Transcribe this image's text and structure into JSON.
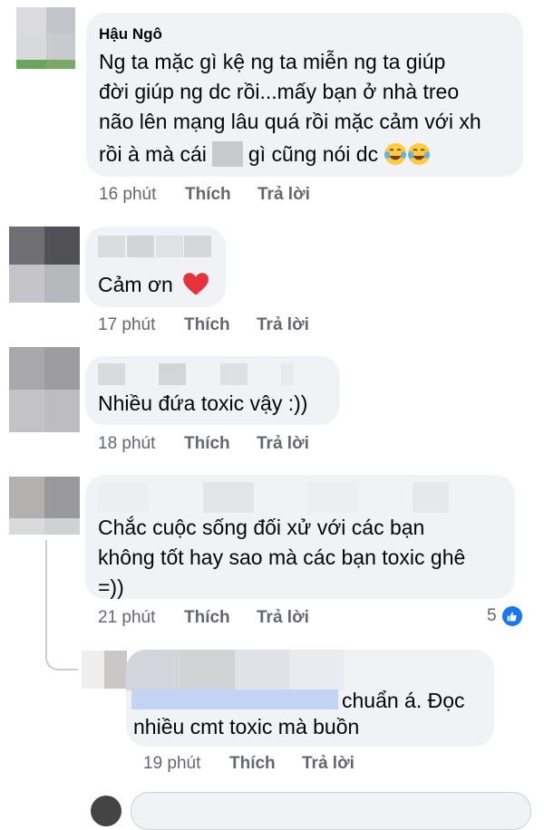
{
  "comments": [
    {
      "author": "Hậu Ngô",
      "text_line1": "Ng ta mặc gì kệ ng ta miễn ng ta giúp",
      "text_line2": "đời giúp ng dc rồi...mấy bạn ở nhà treo",
      "text_line3": "não lên mạng lâu quá rồi mặc cảm với xh",
      "text_line4_a": "rồi à mà cái",
      "text_line4_b": "gì cũng nói dc",
      "time": "16 phút",
      "like": "Thích",
      "reply": "Trả lời"
    },
    {
      "text": "Cảm ơn",
      "time": "17 phút",
      "like": "Thích",
      "reply": "Trả lời"
    },
    {
      "text": "Nhiều đứa toxic vậy :))",
      "time": "18 phút",
      "like": "Thích",
      "reply": "Trả lời"
    },
    {
      "text_line1": "Chắc cuộc sống đối xử với các bạn",
      "text_line2": "không tốt hay sao mà các bạn toxic ghê",
      "text_line3": "=))",
      "time": "21 phút",
      "like": "Thích",
      "reply": "Trả lời",
      "reaction_count": "5"
    },
    {
      "text_line1": "chuẩn á. Đọc",
      "text_line2": "nhiều cmt toxic mà buồn",
      "time": "19 phút",
      "like": "Thích",
      "reply": "Trả lời"
    }
  ],
  "icons": {
    "laugh": "face-with-tears-of-joy-icon",
    "heart": "red-heart-icon",
    "like": "thumbs-up-icon"
  },
  "colors": {
    "bubble": "#f0f2f5",
    "meta": "#65676b",
    "like_blue": "#1877f2"
  }
}
